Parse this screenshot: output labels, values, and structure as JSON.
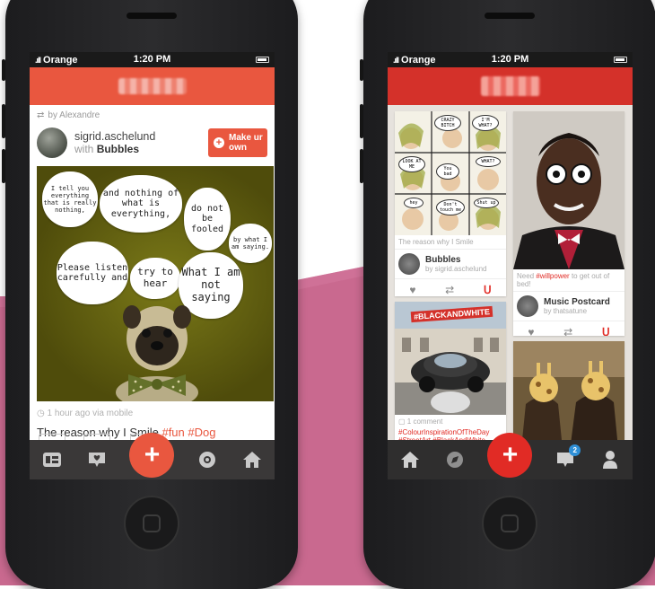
{
  "colors": {
    "pink_background": "#c9698f",
    "left_accent": "#e9573f",
    "right_accent": "#d4312a",
    "tabbar": "#3a3838"
  },
  "left_phone": {
    "status": {
      "carrier": "Orange",
      "time": "1:20 PM"
    },
    "post": {
      "repost_text": "by Alexandre",
      "username": "sigrid.aschelund",
      "with_prefix": "with",
      "collection": "Bubbles",
      "make_button_label": "Make ur own",
      "meme_bubbles": [
        "I tell you everything that is really nothing,",
        "and nothing of what is everything,",
        "do not be fooled",
        "by what I am saying.",
        "Please listen carefully and",
        "try to hear",
        "What I am not saying"
      ],
      "meta": "1 hour ago via mobile",
      "caption_text": "The reason why I Smile",
      "caption_tags": [
        "#fun",
        "#Dog"
      ]
    },
    "tabbar": {
      "icons": [
        "collections-icon",
        "heart-message-icon",
        "add-icon",
        "camera-icon",
        "home-icon"
      ],
      "add_glyph": "+"
    }
  },
  "right_phone": {
    "status": {
      "carrier": "Orange",
      "time": "1:20 PM"
    },
    "cards": [
      {
        "caption": "The reason why I Smile",
        "collection": "Bubbles",
        "owner": "by sigrid.aschelund",
        "comic_words": [
          "CRAZY BITCH",
          "I'M WHAT?",
          "LOOK AT ME",
          "WHAT?",
          "You bad",
          "hey",
          "Don't touch me",
          "Shut up"
        ]
      },
      {
        "caption_prefix": "Need",
        "caption_tag": "#willpower",
        "caption_suffix": "to get out of bed!",
        "collection": "Music Postcard",
        "owner": "by thatsatune"
      },
      {
        "headline": "#BLACKANDWHITE",
        "comment_count": "1 comment",
        "tags": "#ColourInspirationOfTheDay #StreetArt #BlackAndWhite"
      },
      {
        "caption": ""
      }
    ],
    "tabbar": {
      "icons": [
        "home-icon",
        "compass-icon",
        "add-icon",
        "messages-icon",
        "profile-icon"
      ],
      "add_glyph": "+",
      "badge_count": "2"
    }
  }
}
